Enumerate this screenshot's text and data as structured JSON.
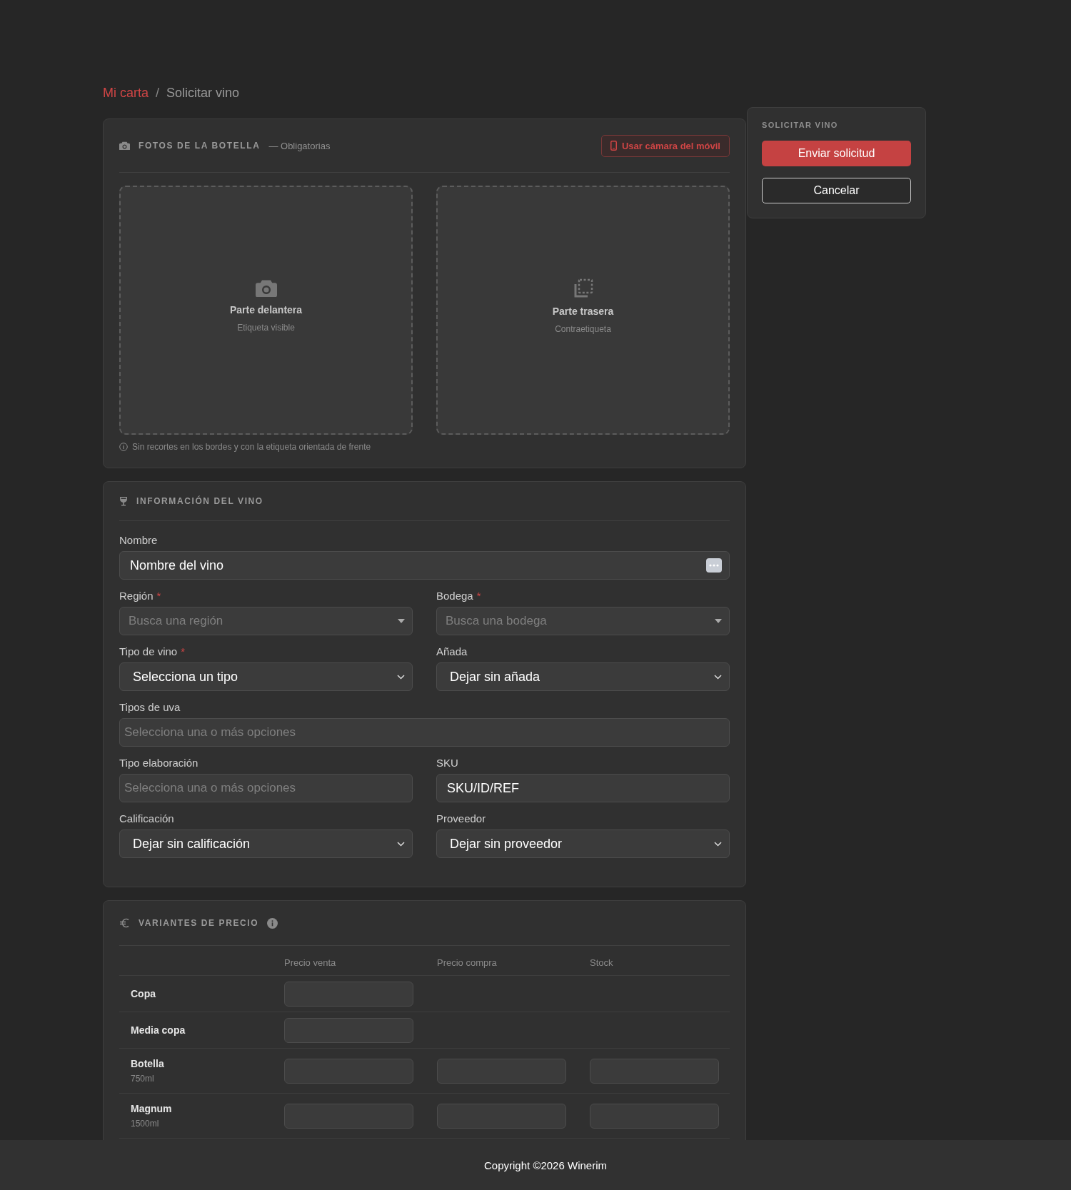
{
  "breadcrumb": [
    {
      "label": "Mi carta",
      "kind": "link"
    },
    {
      "label": "/",
      "kind": "separator"
    },
    {
      "label": "Solicitar vino",
      "kind": "current"
    }
  ],
  "photos": {
    "title": "FOTOS DE LA BOTELLA",
    "subtitle": "— Obligatorias",
    "camera_button": "Usar cámara del móvil",
    "dropzones": [
      {
        "kind": "front",
        "title": "Parte delantera",
        "hint": "Etiqueta visible"
      },
      {
        "kind": "back",
        "title": "Parte trasera",
        "hint": "Contraetiqueta"
      }
    ],
    "note": "Sin recortes en los bordes y con la etiqueta orientada de frente"
  },
  "info": {
    "title": "INFORMACIÓN DEL VINO",
    "rows": [
      [
        {
          "label": "Nombre",
          "kind": "text",
          "value": "Nombre del vino"
        }
      ],
      [
        {
          "label": "Región",
          "required_mark": "*",
          "kind": "search",
          "placeholder": "Busca una región"
        },
        {
          "label": "Bodega",
          "required_mark": "*",
          "kind": "search",
          "placeholder": "Busca una bodega"
        }
      ],
      [
        {
          "label": "Tipo de vino",
          "required_mark": "*",
          "kind": "select",
          "value": "Selecciona un tipo"
        },
        {
          "label": "Añada",
          "kind": "select",
          "value": "Dejar sin añada"
        }
      ],
      [
        {
          "label": "Tipos de uva",
          "kind": "multi",
          "placeholder": "Selecciona una o más opciones"
        }
      ],
      [
        {
          "label": "Tipo elaboración",
          "kind": "multi",
          "placeholder": "Selecciona una o más opciones"
        },
        {
          "label": "SKU",
          "kind": "plain",
          "value": "SKU/ID/REF"
        }
      ],
      [
        {
          "label": "Calificación",
          "kind": "select",
          "value": "Dejar sin calificación"
        },
        {
          "label": "Proveedor",
          "kind": "select",
          "value": "Dejar sin proveedor"
        }
      ]
    ]
  },
  "prices": {
    "title": "VARIANTES DE PRECIO",
    "columns": [
      "Precio venta",
      "Precio compra",
      "Stock"
    ],
    "rows": [
      {
        "name": "Copa",
        "kind": "glass"
      },
      {
        "name": "Media copa",
        "kind": "glass"
      },
      {
        "name": "Botella",
        "size": "750ml",
        "kind": "bottle"
      },
      {
        "name": "Magnum",
        "size": "1500ml",
        "kind": "bottle"
      }
    ]
  },
  "sidebar": {
    "title": "SOLICITAR VINO",
    "buttons": [
      {
        "label": "Enviar solicitud",
        "kind": "primary"
      },
      {
        "label": "Cancelar",
        "kind": "secondary"
      }
    ]
  },
  "footer": "Copyright ©2026 Winerim"
}
